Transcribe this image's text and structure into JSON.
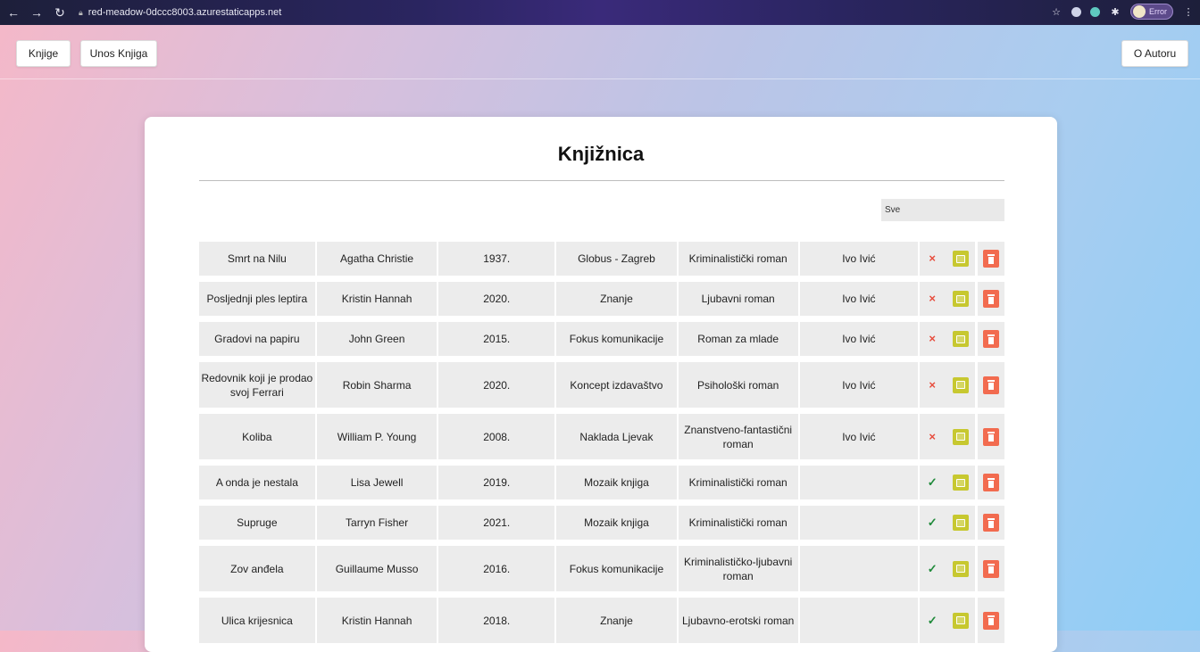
{
  "browser": {
    "url": "red-meadow-0dccc8003.azurestaticapps.net",
    "profile_status": "Error"
  },
  "nav": {
    "books": "Knjige",
    "add_book": "Unos Knjiga",
    "about": "O Autoru"
  },
  "page": {
    "title": "Knjižnica",
    "filter_value": "Sve"
  },
  "books": [
    {
      "title": "Smrt na Nilu",
      "author": "Agatha Christie",
      "year": "1937.",
      "publisher": "Globus - Zagreb",
      "genre": "Kriminalistički roman",
      "borrower": "Ivo Ivić",
      "status": "unavailable"
    },
    {
      "title": "Posljednji ples leptira",
      "author": "Kristin Hannah",
      "year": "2020.",
      "publisher": "Znanje",
      "genre": "Ljubavni roman",
      "borrower": "Ivo Ivić",
      "status": "unavailable"
    },
    {
      "title": "Gradovi na papiru",
      "author": "John Green",
      "year": "2015.",
      "publisher": "Fokus komunikacije",
      "genre": "Roman za mlade",
      "borrower": "Ivo Ivić",
      "status": "unavailable"
    },
    {
      "title": "Redovnik koji je prodao svoj Ferrari",
      "author": "Robin Sharma",
      "year": "2020.",
      "publisher": "Koncept izdavaštvo",
      "genre": "Psihološki roman",
      "borrower": "Ivo Ivić",
      "status": "unavailable"
    },
    {
      "title": "Koliba",
      "author": "William P. Young",
      "year": "2008.",
      "publisher": "Naklada Ljevak",
      "genre": "Znanstveno-fantastični roman",
      "borrower": "Ivo Ivić",
      "status": "unavailable"
    },
    {
      "title": "A onda je nestala",
      "author": "Lisa Jewell",
      "year": "2019.",
      "publisher": "Mozaik knjiga",
      "genre": "Kriminalistički roman",
      "borrower": "",
      "status": "available"
    },
    {
      "title": "Supruge",
      "author": "Tarryn Fisher",
      "year": "2021.",
      "publisher": "Mozaik knjiga",
      "genre": "Kriminalistički roman",
      "borrower": "",
      "status": "available"
    },
    {
      "title": "Zov anđela",
      "author": "Guillaume Musso",
      "year": "2016.",
      "publisher": "Fokus komunikacije",
      "genre": "Kriminalističko-ljubavni roman",
      "borrower": "",
      "status": "available"
    },
    {
      "title": "Ulica krijesnica",
      "author": "Kristin Hannah",
      "year": "2018.",
      "publisher": "Znanje",
      "genre": "Ljubavno-erotski roman",
      "borrower": "",
      "status": "available"
    }
  ],
  "status_icons": {
    "unavailable": "×",
    "available": "✓"
  },
  "colors": {
    "edit": "#c7c830",
    "delete": "#f26b4f",
    "unavailable": "#e74c3c",
    "available": "#1f8a3a"
  }
}
